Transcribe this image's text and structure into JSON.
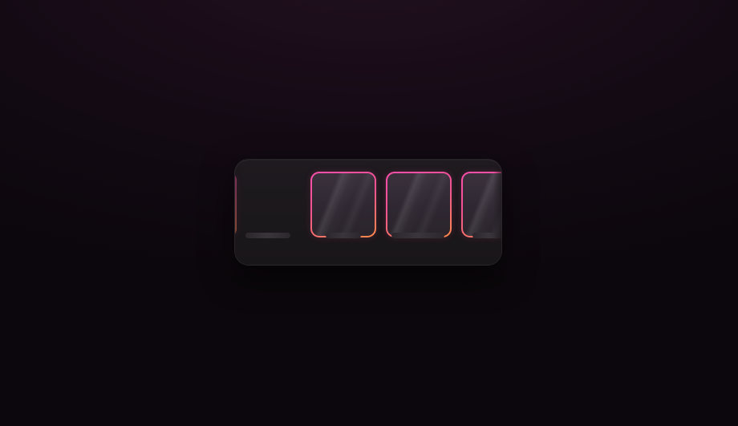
{
  "carousel": {
    "items": [
      {
        "name": "tile-1",
        "state": "partially-visible-left",
        "label": ""
      },
      {
        "name": "tile-2",
        "state": "visible",
        "label": ""
      },
      {
        "name": "tile-3",
        "state": "visible",
        "label": ""
      },
      {
        "name": "tile-4",
        "state": "partially-visible-right",
        "label": ""
      }
    ],
    "colors": {
      "page_background": "#0b070c",
      "panel_background": "#1b181b",
      "tile_fill": "#312a34",
      "border_gradient_start": "#ff4fae",
      "border_gradient_end": "#ff8a4a",
      "label_placeholder": "#333034"
    }
  }
}
